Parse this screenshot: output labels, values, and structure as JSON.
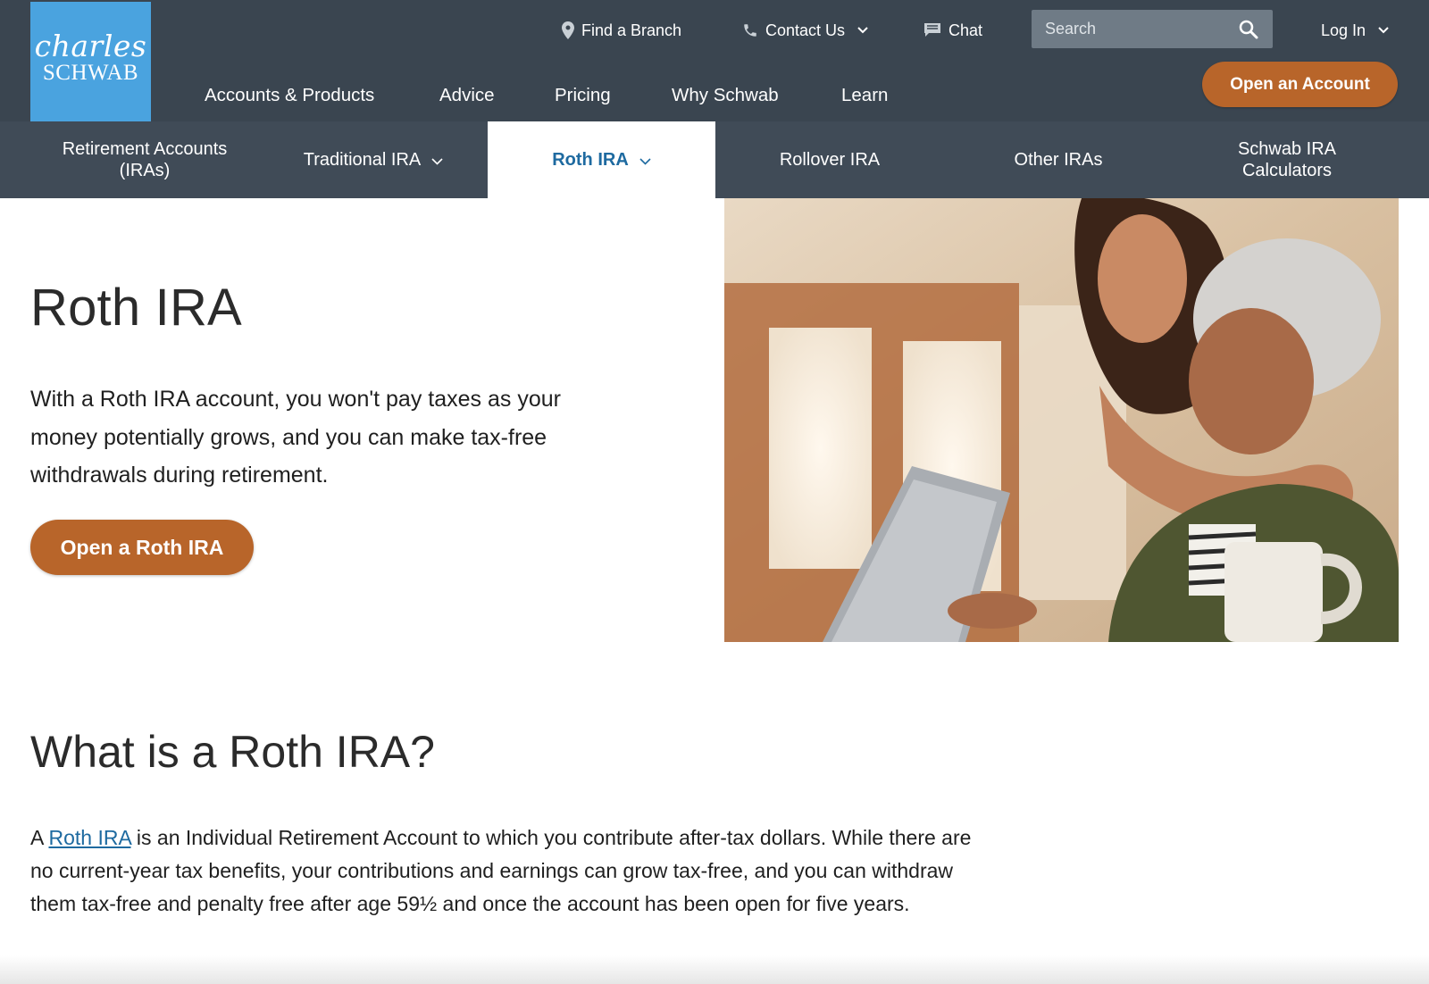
{
  "brand": {
    "logo_script": "charles",
    "logo_caps": "SCHWAB",
    "logo_color": "#4aa3df"
  },
  "utility_nav": {
    "find_branch": "Find a Branch",
    "contact_us": "Contact Us",
    "chat": "Chat",
    "search_placeholder": "Search",
    "log_in": "Log In"
  },
  "main_nav": {
    "items": [
      "Accounts & Products",
      "Advice",
      "Pricing",
      "Why Schwab",
      "Learn"
    ],
    "open_account": "Open an Account"
  },
  "sub_nav": {
    "items": [
      {
        "label": "Retirement Accounts\n(IRAs)",
        "dropdown": false,
        "active": false
      },
      {
        "label": "Traditional IRA",
        "dropdown": true,
        "active": false
      },
      {
        "label": "Roth IRA",
        "dropdown": true,
        "active": true
      },
      {
        "label": "Rollover IRA",
        "dropdown": false,
        "active": false
      },
      {
        "label": "Other IRAs",
        "dropdown": false,
        "active": false
      },
      {
        "label": "Schwab IRA\nCalculators",
        "dropdown": false,
        "active": false
      }
    ]
  },
  "hero": {
    "title": "Roth IRA",
    "description": "With a Roth IRA account, you won't pay taxes as your money potentially grows, and you can make tax-free withdrawals during retirement.",
    "cta": "Open a Roth IRA"
  },
  "section": {
    "title": "What is a Roth IRA?",
    "body_prefix": "A ",
    "body_link": "Roth IRA",
    "body_rest": " is an Individual Retirement Account to which you contribute after-tax dollars. While there are no current-year tax benefits, your contributions and earnings can grow tax-free, and you can withdraw them tax-free and penalty free after age 59½ and once the account has been open for five years."
  },
  "colors": {
    "header_bg": "#3a4550",
    "subnav_bg": "#404b57",
    "accent_orange": "#b8652a",
    "link_blue": "#1e6aa0"
  },
  "icons": {
    "find_branch": "map-pin-icon",
    "contact_us": "phone-icon",
    "chat": "chat-icon",
    "search": "search-icon",
    "dropdown": "chevron-down-icon"
  }
}
